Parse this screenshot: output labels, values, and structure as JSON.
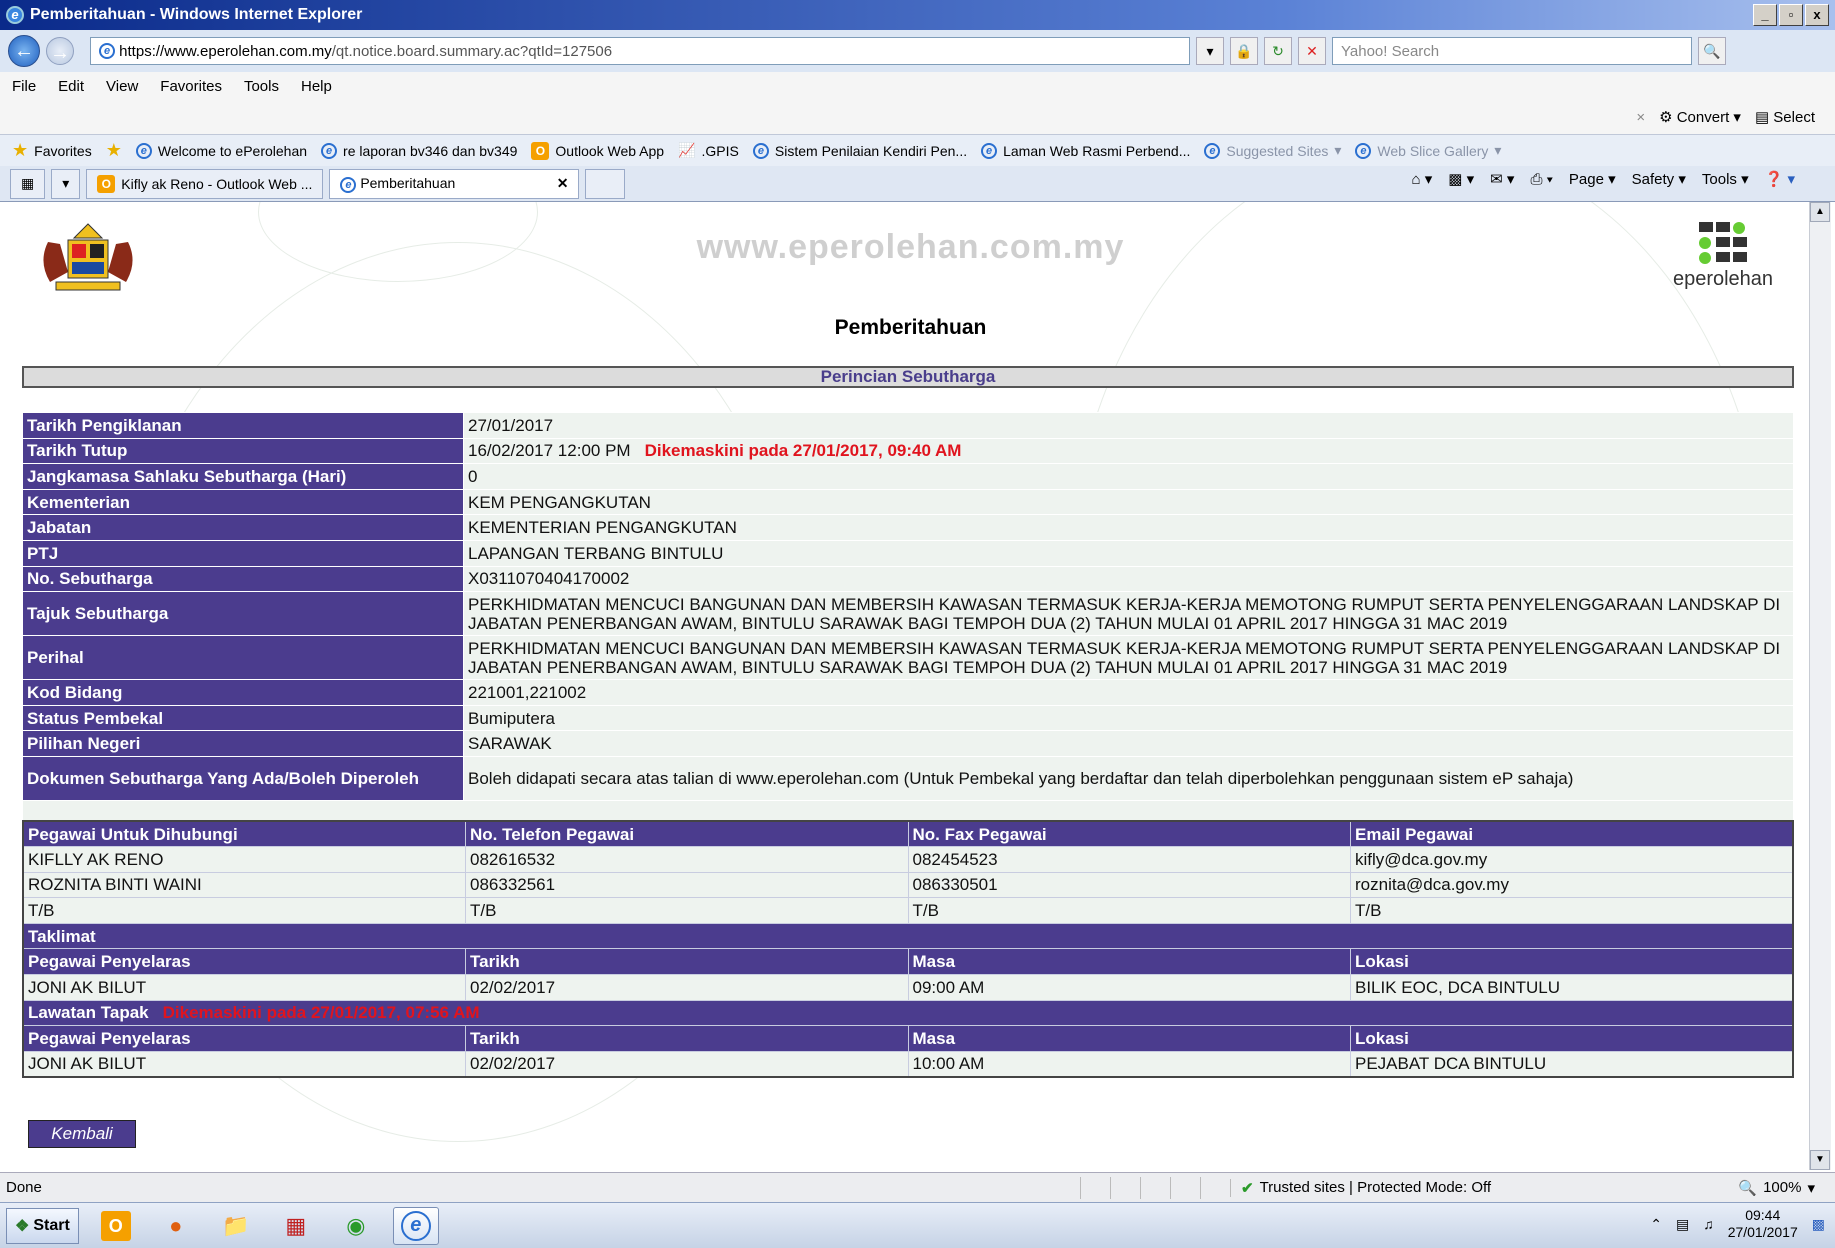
{
  "window": {
    "title": "Pemberitahuan - Windows Internet Explorer",
    "controls": [
      "_",
      "▫",
      "x"
    ]
  },
  "address": {
    "scheme": "https://www.",
    "host": "eperolehan.com.my",
    "path": "/qt.notice.board.summary.ac?qtId=127506",
    "search_placeholder": "Yahoo! Search"
  },
  "menu": [
    "File",
    "Edit",
    "View",
    "Favorites",
    "Tools",
    "Help"
  ],
  "menubar_right": {
    "close": "×",
    "convert": "Convert",
    "select": "Select"
  },
  "favorites": {
    "label": "Favorites",
    "items": [
      "Welcome to ePerolehan",
      "re laporan bv346 dan bv349",
      "Outlook Web App",
      ".GPIS",
      "Sistem Penilaian Kendiri Pen...",
      "Laman Web Rasmi Perbend..."
    ],
    "faded": [
      "Suggested Sites",
      "Web Slice Gallery"
    ]
  },
  "tabs": [
    "Kifly ak Reno - Outlook Web ...",
    "Pemberitahuan"
  ],
  "cmdbar": [
    "Page",
    "Safety",
    "Tools"
  ],
  "page": {
    "watermark_url": "www.eperolehan.com.my",
    "logo_text": "eperolehan",
    "title": "Pemberitahuan",
    "section": "Perincian Sebutharga",
    "info": [
      {
        "label": "Tarikh Pengiklanan",
        "value": "27/01/2017"
      },
      {
        "label": "Tarikh Tutup",
        "value": "16/02/2017 12:00 PM",
        "note": "Dikemaskini pada 27/01/2017, 09:40 AM"
      },
      {
        "label": "Jangkamasa Sahlaku Sebutharga (Hari)",
        "value": "0"
      },
      {
        "label": "Kementerian",
        "value": "KEM PENGANGKUTAN"
      },
      {
        "label": "Jabatan",
        "value": "KEMENTERIAN PENGANGKUTAN"
      },
      {
        "label": "PTJ",
        "value": "LAPANGAN TERBANG BINTULU"
      },
      {
        "label": "No. Sebutharga",
        "value": "X0311070404170002"
      },
      {
        "label": "Tajuk Sebutharga",
        "value": "PERKHIDMATAN MENCUCI BANGUNAN DAN MEMBERSIH KAWASAN TERMASUK KERJA-KERJA MEMOTONG RUMPUT SERTA PENYELENGGARAAN LANDSKAP DI JABATAN PENERBANGAN AWAM, BINTULU SARAWAK BAGI TEMPOH DUA (2) TAHUN MULAI 01 APRIL 2017 HINGGA 31 MAC 2019"
      },
      {
        "label": "Perihal",
        "value": "PERKHIDMATAN MENCUCI BANGUNAN DAN MEMBERSIH KAWASAN TERMASUK KERJA-KERJA MEMOTONG RUMPUT SERTA PENYELENGGARAAN LANDSKAP DI JABATAN PENERBANGAN AWAM, BINTULU SARAWAK BAGI TEMPOH DUA (2) TAHUN MULAI 01 APRIL 2017 HINGGA 31 MAC 2019"
      },
      {
        "label": "Kod Bidang",
        "value": "221001,221002"
      },
      {
        "label": "Status Pembekal",
        "value": "Bumiputera"
      },
      {
        "label": "Pilihan Negeri",
        "value": "SARAWAK"
      },
      {
        "label": "Dokumen Sebutharga Yang Ada/Boleh Diperoleh",
        "value": "Boleh didapati secara atas talian di www.eperolehan.com (Untuk Pembekal yang berdaftar dan telah diperbolehkan penggunaan sistem eP sahaja)"
      }
    ],
    "contacts": {
      "headers": [
        "Pegawai Untuk Dihubungi",
        "No. Telefon Pegawai",
        "No. Fax Pegawai",
        "Email Pegawai"
      ],
      "rows": [
        [
          "KIFLLY AK RENO",
          "082616532",
          "082454523",
          "kifly@dca.gov.my"
        ],
        [
          "ROZNITA BINTI WAINI",
          "086332561",
          "086330501",
          "roznita@dca.gov.my"
        ],
        [
          "T/B",
          "T/B",
          "T/B",
          "T/B"
        ]
      ]
    },
    "taklimat": {
      "title": "Taklimat",
      "headers": [
        "Pegawai Penyelaras",
        "Tarikh",
        "Masa",
        "Lokasi"
      ],
      "row": [
        "JONI AK BILUT",
        "02/02/2017",
        "09:00 AM",
        "BILIK EOC, DCA BINTULU"
      ]
    },
    "lawatan": {
      "title": "Lawatan Tapak",
      "note": "Dikemaskini pada 27/01/2017, 07:56 AM",
      "headers": [
        "Pegawai Penyelaras",
        "Tarikh",
        "Masa",
        "Lokasi"
      ],
      "row": [
        "JONI AK BILUT",
        "02/02/2017",
        "10:00 AM",
        "PEJABAT DCA BINTULU"
      ]
    },
    "back_button": "Kembali"
  },
  "status": {
    "left": "Done",
    "zone": "Trusted sites | Protected Mode: Off",
    "zoom": "100%"
  },
  "taskbar": {
    "start": "Start",
    "time": "09:44",
    "date": "27/01/2017"
  }
}
